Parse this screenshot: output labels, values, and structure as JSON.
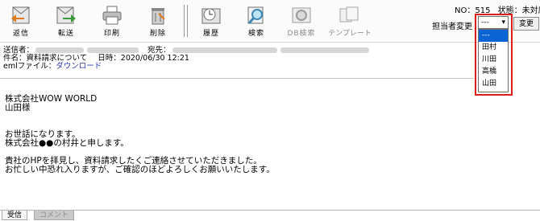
{
  "toolbar": {
    "buttons": [
      {
        "label": "返信",
        "icon": "reply-icon"
      },
      {
        "label": "転送",
        "icon": "forward-icon"
      },
      {
        "label": "印刷",
        "icon": "printer-icon"
      },
      {
        "label": "削除",
        "icon": "trash-icon"
      },
      {
        "label": "履歴",
        "icon": "history-icon"
      },
      {
        "label": "検索",
        "icon": "magnifier-icon"
      },
      {
        "label": "DB検索",
        "icon": "db-search-icon"
      },
      {
        "label": "テンプレート",
        "icon": "template-icon"
      }
    ]
  },
  "status": {
    "no_label": "NO：515",
    "state_label": "状態：未対応"
  },
  "owner": {
    "label": "担当者変更",
    "selected": "---",
    "options": [
      "---",
      "田村",
      "川田",
      "高橋",
      "山田"
    ],
    "change_button": "変更"
  },
  "mail": {
    "from_label": "送信者：",
    "to_label": "宛先：",
    "subject_label": "件名：",
    "subject": "資料請求について",
    "date_label": "日時：",
    "date": "2020/06/30 12:21",
    "eml_label": "emlファイル：",
    "eml_link": "ダウンロード",
    "body": "株式会社WOW WORLD\n山田様\n\n\nお世話になります。\n株式会社●●の村井と申します。\n\n貴社のHPを拝見し、資料請求したくご連絡させていただきました。\nお忙しい中恐れ入りますが、ご確認のほどよろしくお願いいたします。"
  },
  "tabs": [
    {
      "label": "受信"
    },
    {
      "label": "コメント"
    }
  ],
  "colors": {
    "highlight": "#e21a1a",
    "selected_option": "#0a64d6",
    "link": "#2a35b8"
  }
}
